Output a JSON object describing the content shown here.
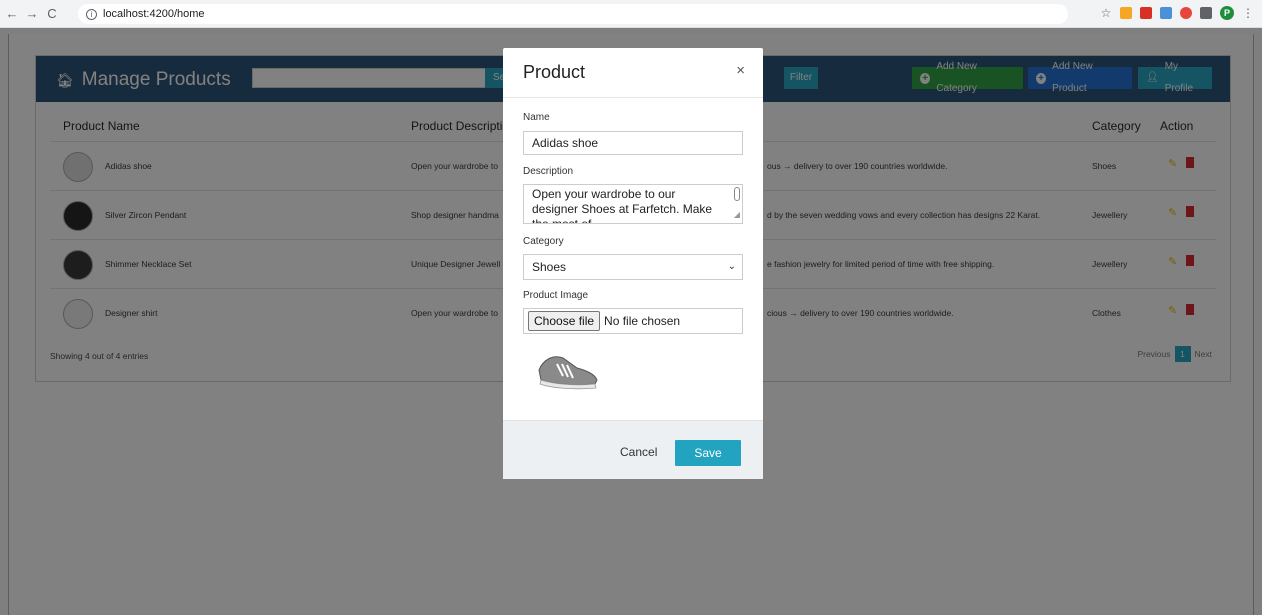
{
  "browser": {
    "url": "localhost:4200/home",
    "back_glyph": "←",
    "forward_glyph": "→",
    "reload_glyph": "C",
    "avatar_letter": "P"
  },
  "header": {
    "title": "Manage Products",
    "search_label": "Sea",
    "filter_label": "Filter",
    "add_category_label": "Add New Category",
    "add_product_label": "Add New Product",
    "profile_label": "My Profile"
  },
  "table": {
    "columns": [
      "Product Name",
      "Product Descriptio",
      "Category",
      "Action"
    ],
    "rows": [
      {
        "name": "Adidas shoe",
        "desc": "Open your wardrobe to",
        "desc2": "ous → delivery to over 190 countries worldwide.",
        "category": "Shoes"
      },
      {
        "name": "Silver Zircon Pendant",
        "desc": "Shop designer handma",
        "desc2": "d by the seven wedding vows and every collection has designs 22 Karat.",
        "category": "Jewellery"
      },
      {
        "name": "Shimmer Necklace Set",
        "desc": "Unique Designer Jewell",
        "desc2": "e fashion jewelry for limited period of time with free shipping.",
        "category": "Jewellery"
      },
      {
        "name": "Designer shirt",
        "desc": "Open your wardrobe to",
        "desc2": "cious → delivery to over 190 countries worldwide.",
        "category": "Clothes"
      }
    ],
    "showing": "Showing 4 out of 4 entries",
    "pager": {
      "previous": "Previous",
      "current": "1",
      "next": "Next"
    }
  },
  "modal": {
    "title": "Product",
    "close": "×",
    "name_label": "Name",
    "name_value": "Adidas shoe",
    "description_label": "Description",
    "description_value": "Open your wardrobe to our designer Shoes at Farfetch. Make the most of",
    "category_label": "Category",
    "category_value": "Shoes",
    "image_label": "Product Image",
    "choose_file": "Choose file",
    "no_file": "No file chosen",
    "cancel": "Cancel",
    "save": "Save"
  },
  "colors": {
    "header_bg": "#264f79",
    "teal": "#22a3c0",
    "green": "#2b9f3f",
    "blue": "#1f6fd6",
    "delete_red": "#d9232d",
    "edit_yellow": "#f0b400"
  }
}
